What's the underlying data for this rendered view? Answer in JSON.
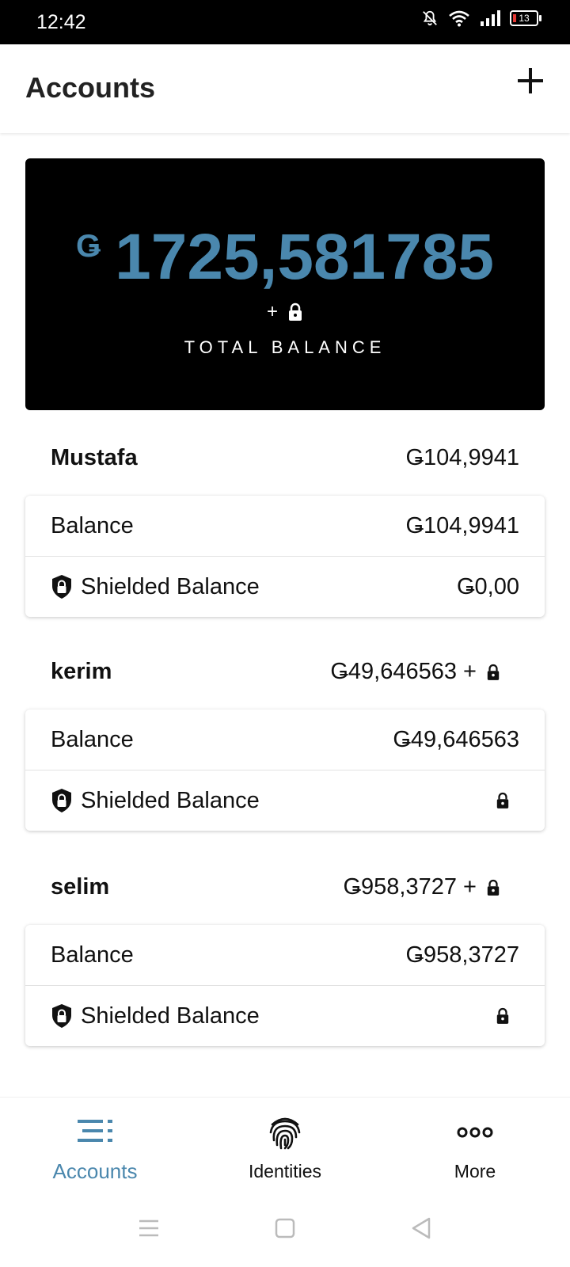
{
  "status_bar": {
    "time": "12:42",
    "battery": "13"
  },
  "app_bar": {
    "title": "Accounts",
    "add_icon": "plus-icon"
  },
  "total": {
    "currency": "Ǥ",
    "amount": "1725,581785",
    "extra": "+",
    "label": "TOTAL BALANCE"
  },
  "accounts": [
    {
      "name": "Mustafa",
      "total": "Ǥ104,9941",
      "balance_label": "Balance",
      "balance_value": "Ǥ104,9941",
      "shielded_label": "Shielded Balance",
      "shielded_value": "Ǥ0,00"
    },
    {
      "name": "kerim",
      "total": "Ǥ49,646563 +",
      "balance_label": "Balance",
      "balance_value": "Ǥ49,646563",
      "shielded_label": "Shielded Balance",
      "shielded_value": ""
    },
    {
      "name": "selim",
      "total": "Ǥ958,3727 +",
      "balance_label": "Balance",
      "balance_value": "Ǥ958,3727",
      "shielded_label": "Shielded Balance",
      "shielded_value": ""
    }
  ],
  "bottom_nav": {
    "items": [
      {
        "label": "Accounts",
        "icon": "list-icon",
        "active": true
      },
      {
        "label": "Identities",
        "icon": "fingerprint-icon",
        "active": false
      },
      {
        "label": "More",
        "icon": "more-icon",
        "active": false
      }
    ]
  },
  "colors": {
    "accent": "#4a87ad",
    "card_dark": "#000000"
  }
}
